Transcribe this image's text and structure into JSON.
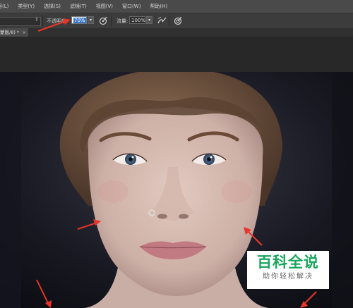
{
  "menubar": {
    "items": [
      "层(L)",
      "类型(Y)",
      "选择(S)",
      "滤镜(T)",
      "视图(V)",
      "窗口(W)",
      "帮助(H)"
    ]
  },
  "options_bar": {
    "opacity_label": "不透明度:",
    "opacity_value": "70%",
    "flow_label": "流量:",
    "flow_value": "100%",
    "dropdown_arrow": "▾",
    "brush_arrow": "⇕",
    "icons": [
      "pressure-opacity-icon",
      "airbrush-icon",
      "pressure-size-icon"
    ]
  },
  "document": {
    "tab_label": "蒙版/8) *",
    "tab_close": "×"
  },
  "watermark": {
    "title": "百科全说",
    "subtitle": "助你轻松解决"
  },
  "colors": {
    "menubar_bg": "#4a4a4a",
    "optbar_bg": "#3c3c3c",
    "selection": "#3a77c4",
    "arrow_red": "#e8352a",
    "watermark_green": "#19a55d"
  }
}
